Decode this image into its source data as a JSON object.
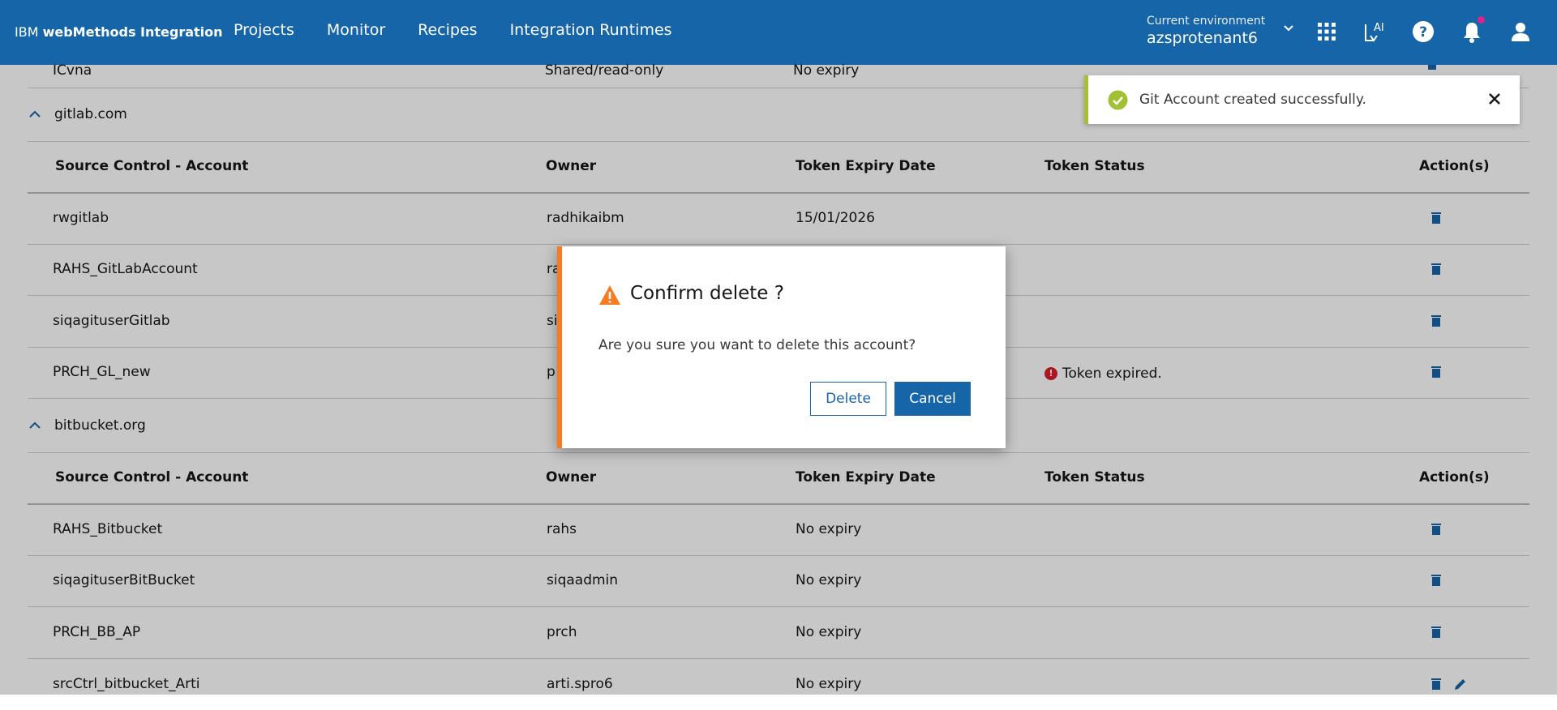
{
  "header": {
    "brand_ibm": "IBM",
    "brand_product": "webMethods Integration",
    "nav": [
      "Projects",
      "Monitor",
      "Recipes",
      "Integration Runtimes"
    ],
    "env_label": "Current environment",
    "env_value": "azsprotenant6",
    "ai_label": "AI"
  },
  "colors": {
    "header_bg": "#1565a8",
    "accent": "#1565a8",
    "success": "#a2c033",
    "warning": "#f77b23",
    "error": "#da1e28"
  },
  "columns": {
    "account": "Source Control - Account",
    "owner": "Owner",
    "expiry": "Token Expiry Date",
    "status": "Token Status",
    "actions": "Action(s)"
  },
  "top_row": {
    "account": "ICvna",
    "owner": "Shared/read-only",
    "expiry": "No expiry"
  },
  "groups": [
    {
      "name": "gitlab.com",
      "rows": [
        {
          "account": "rwgitlab",
          "owner": "radhikaibm",
          "expiry": "15/01/2026",
          "status": ""
        },
        {
          "account": "RAHS_GitLabAccount",
          "owner": "ra",
          "expiry": "",
          "status": ""
        },
        {
          "account": "siqagituserGitlab",
          "owner": "si",
          "expiry": "",
          "status": ""
        },
        {
          "account": "PRCH_GL_new",
          "owner": "p",
          "expiry": "",
          "status": "Token expired."
        }
      ]
    },
    {
      "name": "bitbucket.org",
      "rows": [
        {
          "account": "RAHS_Bitbucket",
          "owner": "rahs",
          "expiry": "No expiry",
          "status": ""
        },
        {
          "account": "siqagituserBitBucket",
          "owner": "siqaadmin",
          "expiry": "No expiry",
          "status": ""
        },
        {
          "account": "PRCH_BB_AP",
          "owner": "prch",
          "expiry": "No expiry",
          "status": ""
        },
        {
          "account": "srcCtrl_bitbucket_Arti",
          "owner": "arti.spro6",
          "expiry": "No expiry",
          "status": ""
        }
      ]
    }
  ],
  "toast": {
    "message": "Git Account created successfully."
  },
  "modal": {
    "title": "Confirm delete ?",
    "body": "Are you sure you want to delete this account?",
    "delete_label": "Delete",
    "cancel_label": "Cancel"
  }
}
